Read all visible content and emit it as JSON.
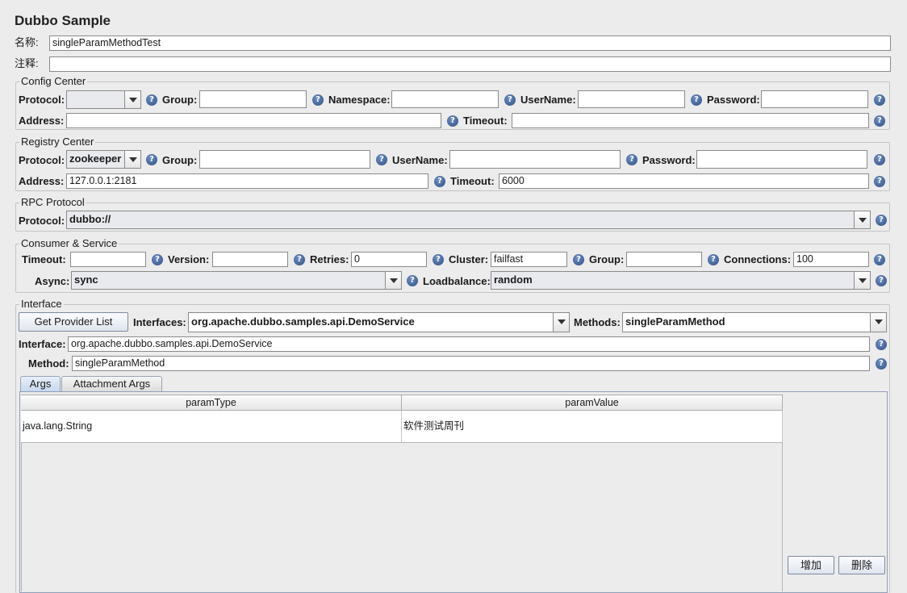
{
  "title": "Dubbo Sample",
  "name_label": "名称:",
  "name_value": "singleParamMethodTest",
  "comment_label": "注释:",
  "comment_value": "",
  "config_center": {
    "title": "Config Center",
    "protocol_label": "Protocol:",
    "protocol_value": "",
    "group_label": "Group:",
    "group_value": "",
    "namespace_label": "Namespace:",
    "namespace_value": "",
    "username_label": "UserName:",
    "username_value": "",
    "password_label": "Password:",
    "password_value": "",
    "address_label": "Address:",
    "address_value": "",
    "timeout_label": "Timeout:",
    "timeout_value": ""
  },
  "registry_center": {
    "title": "Registry Center",
    "protocol_label": "Protocol:",
    "protocol_value": "zookeeper",
    "group_label": "Group:",
    "group_value": "",
    "username_label": "UserName:",
    "username_value": "",
    "password_label": "Password:",
    "password_value": "",
    "address_label": "Address:",
    "address_value": "127.0.0.1:2181",
    "timeout_label": "Timeout:",
    "timeout_value": "6000"
  },
  "rpc_protocol": {
    "title": "RPC Protocol",
    "protocol_label": "Protocol:",
    "protocol_value": "dubbo://"
  },
  "consumer_service": {
    "title": "Consumer & Service",
    "timeout_label": "Timeout:",
    "timeout_value": "",
    "version_label": "Version:",
    "version_value": "",
    "retries_label": "Retries:",
    "retries_value": "0",
    "cluster_label": "Cluster:",
    "cluster_value": "failfast",
    "group_label": "Group:",
    "group_value": "",
    "connections_label": "Connections:",
    "connections_value": "100",
    "async_label": "Async:",
    "async_value": "sync",
    "loadbalance_label": "Loadbalance:",
    "loadbalance_value": "random"
  },
  "interface_section": {
    "title": "Interface",
    "get_provider_button": "Get Provider List",
    "interfaces_label": "Interfaces:",
    "interfaces_value": "org.apache.dubbo.samples.api.DemoService",
    "methods_label": "Methods:",
    "methods_value": "singleParamMethod",
    "interface_label": "Interface:",
    "interface_value": "org.apache.dubbo.samples.api.DemoService",
    "method_label": "Method:",
    "method_value": "singleParamMethod"
  },
  "tabs": [
    "Args",
    "Attachment Args"
  ],
  "args_table": {
    "columns": [
      "paramType",
      "paramValue"
    ],
    "rows": [
      [
        "java.lang.String",
        "软件测试周刊"
      ]
    ]
  },
  "buttons": {
    "add": "增加",
    "delete": "删除"
  },
  "help_glyph": "?",
  "icons": {
    "help": "help-icon",
    "dropdown": "chevron-down-icon"
  }
}
